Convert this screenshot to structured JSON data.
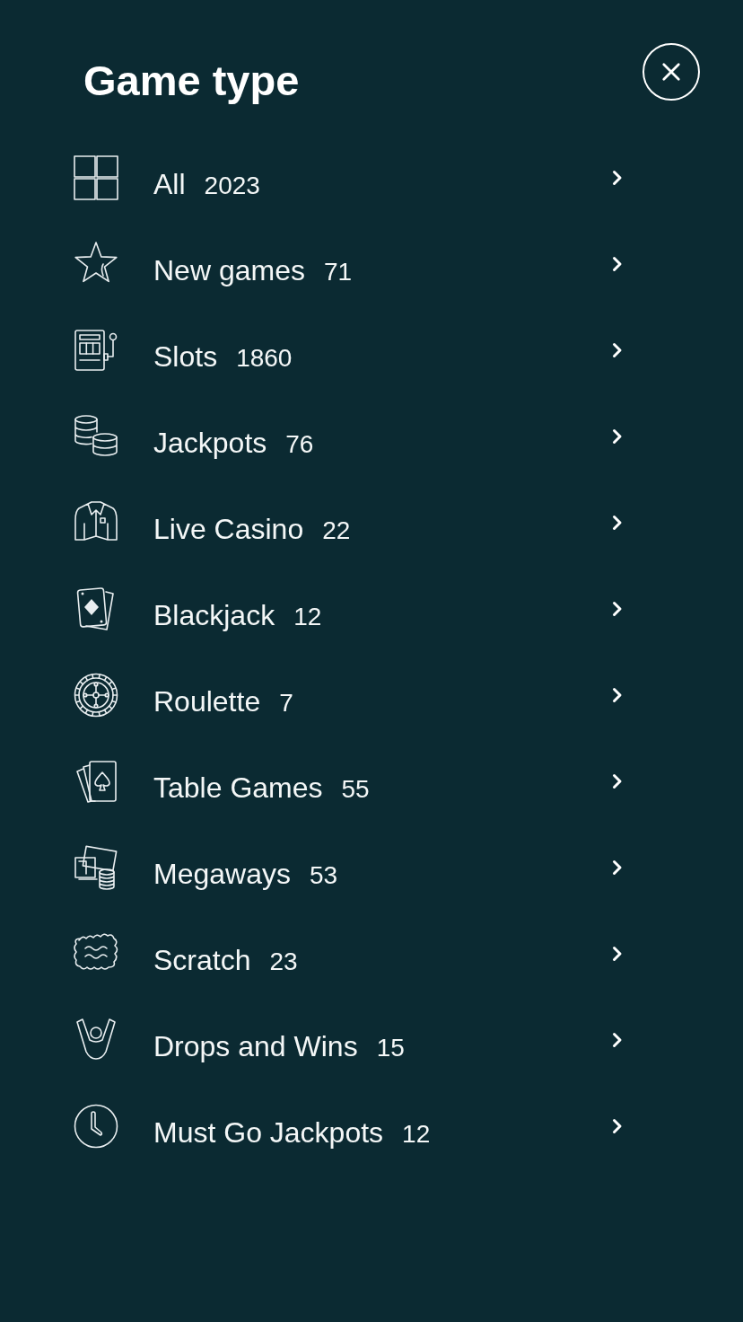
{
  "title": "Game type",
  "categories": [
    {
      "kind": "grid",
      "label": "All",
      "count": "2023"
    },
    {
      "kind": "star",
      "label": "New games",
      "count": "71"
    },
    {
      "kind": "slot",
      "label": "Slots",
      "count": "1860"
    },
    {
      "kind": "coins",
      "label": "Jackpots",
      "count": "76"
    },
    {
      "kind": "shirt",
      "label": "Live Casino",
      "count": "22"
    },
    {
      "kind": "card",
      "label": "Blackjack",
      "count": "12"
    },
    {
      "kind": "wheel",
      "label": "Roulette",
      "count": "7"
    },
    {
      "kind": "cards",
      "label": "Table Games",
      "count": "55"
    },
    {
      "kind": "money",
      "label": "Megaways",
      "count": "53"
    },
    {
      "kind": "badge",
      "label": "Scratch",
      "count": "23"
    },
    {
      "kind": "arms",
      "label": "Drops and Wins",
      "count": "15"
    },
    {
      "kind": "clock",
      "label": "Must Go Jackpots",
      "count": "12"
    }
  ]
}
